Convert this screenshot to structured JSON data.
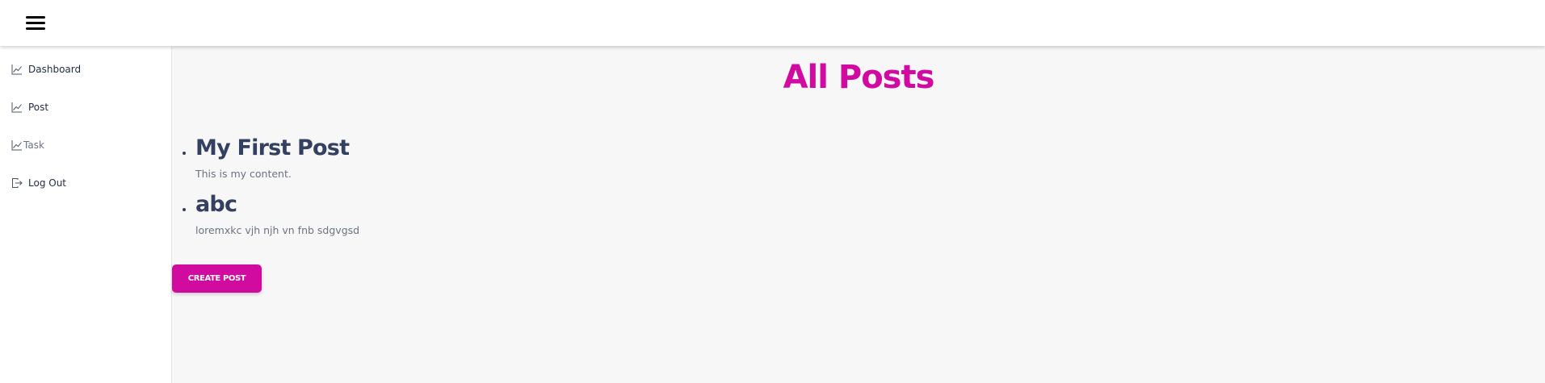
{
  "topbar": {
    "menu_icon": "hamburger-menu-icon"
  },
  "sidebar": {
    "items": [
      {
        "label": "Dashboard",
        "icon": "line-chart-icon"
      },
      {
        "label": "Post",
        "icon": "line-chart-icon"
      },
      {
        "label": "Task",
        "icon": "line-chart-icon"
      },
      {
        "label": "Log Out",
        "icon": "logout-icon"
      }
    ]
  },
  "main": {
    "title": "All Posts",
    "posts": [
      {
        "title": "My First Post",
        "content": "This is my content."
      },
      {
        "title": "abc",
        "content": "loremxkc vjh njh vn fnb sdgvgsd"
      }
    ],
    "create_button_label": "CREATE POST"
  },
  "colors": {
    "accent": "#d10aa0",
    "post_title": "#334061",
    "sidebar_text": "#1f2a44",
    "background": "#f7f7f7"
  }
}
